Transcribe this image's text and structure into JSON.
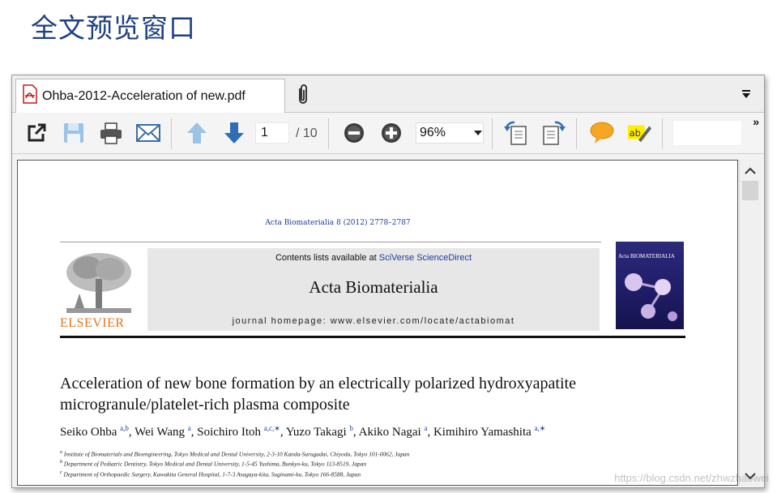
{
  "page_heading": "全文预览窗口",
  "tab": {
    "filename": "Ohba-2012-Acceleration of new.pdf"
  },
  "toolbar": {
    "page_current": "1",
    "page_total": "/ 10",
    "zoom": "96%",
    "more": "»",
    "icons": [
      "open-external-icon",
      "save-icon",
      "print-icon",
      "email-icon",
      "previous-page-icon",
      "next-page-icon",
      "zoom-out-icon",
      "zoom-in-icon",
      "rotate-left-icon",
      "rotate-right-icon",
      "comment-icon",
      "highlight-text-icon"
    ]
  },
  "document": {
    "journal_ref": "Acta Biomaterialia 8 (2012) 2778–2787",
    "contents_prefix": "Contents lists available at ",
    "contents_link": "SciVerse ScienceDirect",
    "journal_name": "Acta Biomaterialia",
    "homepage": "journal homepage: www.elsevier.com/locate/actabiomat",
    "publisher": "ELSEVIER",
    "cover_title": "Acta BIOMATERIALIA",
    "article_title": "Acceleration of new bone formation by an electrically polarized hydroxyapatite microgranule/platelet-rich plasma composite",
    "authors": [
      {
        "name": "Seiko Ohba",
        "sup": "a,b",
        "sep": ", "
      },
      {
        "name": "Wei Wang",
        "sup": "a",
        "sep": ", "
      },
      {
        "name": "Soichiro Itoh",
        "sup": "a,c,∗",
        "sep": ", "
      },
      {
        "name": "Yuzo Takagi",
        "sup": "b",
        "sep": ", "
      },
      {
        "name": "Akiko Nagai",
        "sup": "a",
        "sep": ", "
      },
      {
        "name": "Kimihiro Yamashita",
        "sup": "a,∗",
        "sep": ""
      }
    ],
    "affiliations": [
      {
        "sup": "a",
        "text": "Institute of Biomaterials and Bioengineering, Tokyo Medical and Dental University, 2-3-10 Kanda-Surugadai, Chiyoda, Tokyo 101-0062, Japan"
      },
      {
        "sup": "b",
        "text": "Department of Pediatric Dentistry, Tokyo Medical and Dental University, 1-5-45 Yushima, Bunkyo-ku, Tokyo 113-8519, Japan"
      },
      {
        "sup": "c",
        "text": "Department of Orthopaedic Surgery, Kawakita General Hospital, 1-7-3 Asagaya-kita, Suginami-ku, Tokyo 166-8588, Japan"
      }
    ]
  },
  "watermark": "https://blog.csdn.net/zhwzhaowei",
  "colors": {
    "heading": "#1f3f84",
    "accent_blue": "#3a7fc2",
    "elsevier_orange": "#e8731b",
    "link": "#1c3c9a"
  }
}
